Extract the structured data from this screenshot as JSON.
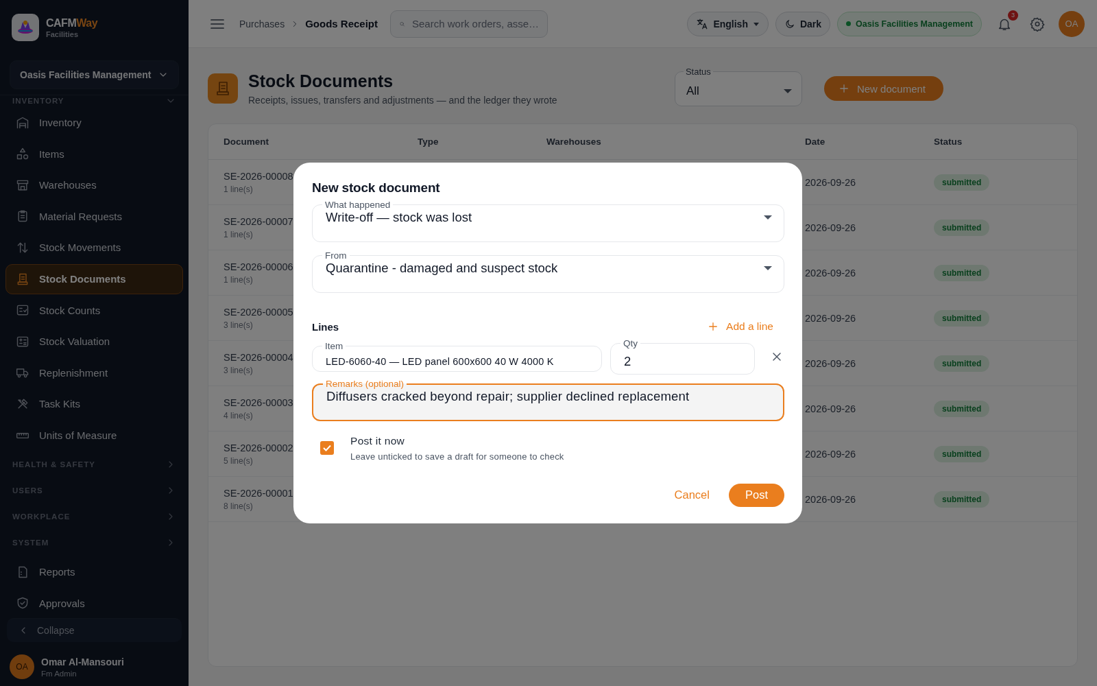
{
  "brand": {
    "name": "CAFM",
    "name_accent": "Way",
    "subtitle": "Facilities"
  },
  "sidebar": {
    "org_selector": "Oasis Facilities Management",
    "sections": [
      {
        "label": "INVENTORY",
        "expanded": true,
        "items": [
          {
            "label": "Inventory",
            "selected": false
          },
          {
            "label": "Items",
            "selected": false
          },
          {
            "label": "Warehouses",
            "selected": false
          },
          {
            "label": "Material Requests",
            "selected": false
          },
          {
            "label": "Stock Movements",
            "selected": false
          },
          {
            "label": "Stock Documents",
            "selected": true
          },
          {
            "label": "Stock Counts",
            "selected": false
          },
          {
            "label": "Stock Valuation",
            "selected": false
          },
          {
            "label": "Replenishment",
            "selected": false
          },
          {
            "label": "Task Kits",
            "selected": false
          },
          {
            "label": "Units of Measure",
            "selected": false
          }
        ]
      },
      {
        "label": "HEALTH & SAFETY",
        "expanded": false
      },
      {
        "label": "USERS",
        "expanded": false
      },
      {
        "label": "WORKPLACE",
        "expanded": false
      },
      {
        "label": "SYSTEM",
        "expanded": false
      }
    ],
    "more_items": [
      {
        "label": "Reports",
        "selected": false
      },
      {
        "label": "Approvals",
        "selected": false
      }
    ],
    "collapse": "Collapse",
    "user": {
      "initials": "OA",
      "name": "Omar Al-Mansouri",
      "role": "Fm Admin"
    }
  },
  "header": {
    "breadcrumb": [
      "Purchases",
      "Goods Receipt"
    ],
    "search": {
      "placeholder": "Search work orders, asse…"
    },
    "language": "English",
    "theme": "Dark",
    "org_badge": "Oasis Facilities Management",
    "notifications": "3",
    "avatar": "OA"
  },
  "page": {
    "title": "Stock Documents",
    "subtitle": "Receipts, issues, transfers and adjustments — and the ledger they wrote",
    "status_filter": {
      "label": "Status",
      "value": "All"
    },
    "new_button": "New document"
  },
  "table": {
    "columns": [
      "Document",
      "Type",
      "Warehouses",
      "Date",
      "Status"
    ],
    "rows": [
      {
        "document": "SE-2026-00008",
        "lines": "1 line(s)",
        "date": "2026-09-26",
        "status": "submitted"
      },
      {
        "document": "SE-2026-00007",
        "lines": "1 line(s)",
        "date": "2026-09-26",
        "status": "submitted"
      },
      {
        "document": "SE-2026-00006",
        "lines": "1 line(s)",
        "date": "2026-09-26",
        "status": "submitted"
      },
      {
        "document": "SE-2026-00005",
        "lines": "3 line(s)",
        "date": "2026-09-26",
        "status": "submitted"
      },
      {
        "document": "SE-2026-00004",
        "lines": "3 line(s)",
        "date": "2026-09-26",
        "status": "submitted"
      },
      {
        "document": "SE-2026-00003",
        "lines": "4 line(s)",
        "date": "2026-09-26",
        "status": "submitted"
      },
      {
        "document": "SE-2026-00002",
        "lines": "5 line(s)",
        "date": "2026-09-26",
        "status": "submitted"
      },
      {
        "document": "SE-2026-00001",
        "lines": "8 line(s)",
        "date": "2026-09-26",
        "status": "submitted"
      }
    ]
  },
  "dialog": {
    "title": "New stock document",
    "what_happened": {
      "label": "What happened",
      "value": "Write-off — stock was lost"
    },
    "from": {
      "label": "From",
      "value": "Quarantine - damaged and suspect stock"
    },
    "lines_label": "Lines",
    "add_line": "Add a line",
    "line": {
      "item": {
        "label": "Item",
        "value": "LED-6060-40 — LED panel 600x600 40 W 4000 K"
      },
      "qty": {
        "label": "Qty",
        "value": "2"
      }
    },
    "remarks": {
      "label": "Remarks (optional)",
      "value": "Diffusers cracked beyond repair; supplier declined replacement",
      "focused": true
    },
    "post_now": {
      "label": "Post it now",
      "hint": "Leave unticked to save a draft for someone to check",
      "checked": true
    },
    "buttons": {
      "cancel": "Cancel",
      "post": "Post"
    }
  }
}
